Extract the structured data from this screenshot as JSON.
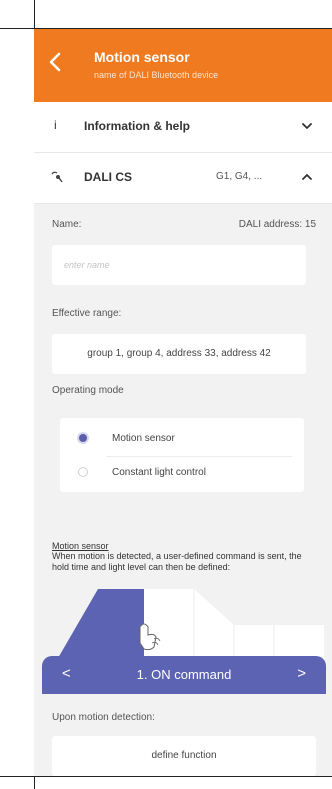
{
  "header": {
    "title": "Motion sensor",
    "subtitle": "name of DALI Bluetooth device",
    "background": "#f07a1f"
  },
  "info_row": {
    "icon": "info-icon",
    "icon_glyph": "i",
    "label": "Information & help"
  },
  "dali_row": {
    "icon": "sensor-icon",
    "label": "DALI CS",
    "value": "G1, G4, ..."
  },
  "form": {
    "name_label": "Name:",
    "dali_address": "DALI address: 15",
    "name_placeholder": "enter name",
    "range_label": "Effective range:",
    "range_value": "group 1, group 4, address 33, address 42",
    "mode_label": "Operating mode",
    "modes": [
      {
        "label": "Motion sensor",
        "selected": true
      },
      {
        "label": "Constant light control",
        "selected": false
      }
    ]
  },
  "description": {
    "title": "Motion sensor",
    "body": "When motion is detected, a user-defined command is sent, the hold time and light level can then be defined:"
  },
  "command_panel": {
    "prev": "<",
    "next": ">",
    "title": "1. ON command",
    "motion_label": "Upon motion detection:",
    "function_label": "define function",
    "accent": "#5d63b3"
  }
}
